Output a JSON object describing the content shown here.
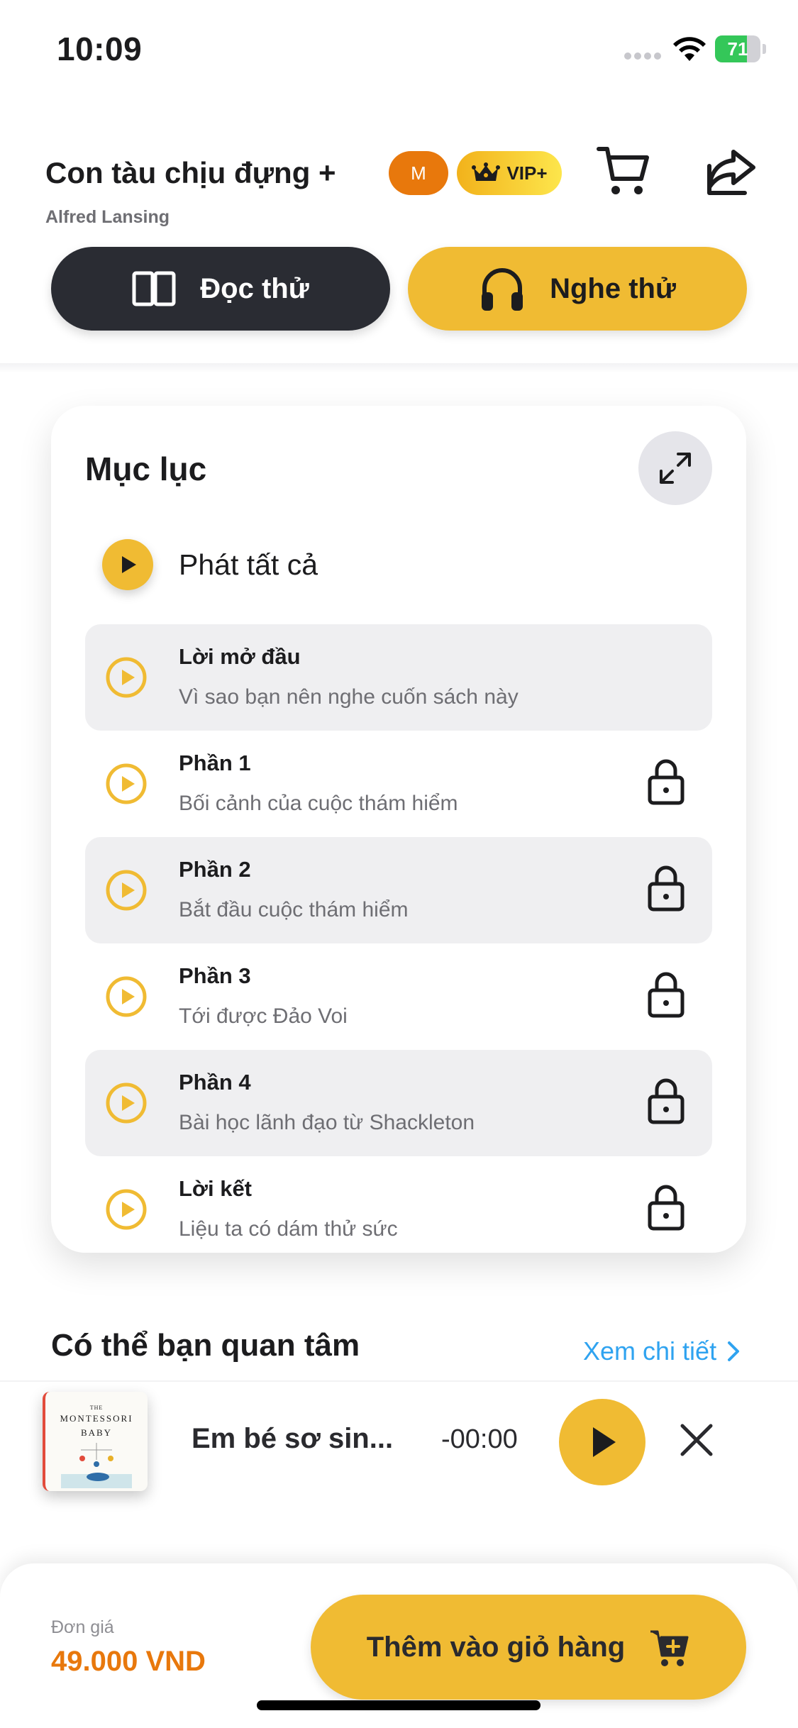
{
  "status_bar": {
    "time": "10:09",
    "battery": "71",
    "battery_level": 0.71
  },
  "header": {
    "title": "Con tàu chịu đựng +",
    "author": "Alfred Lansing",
    "badge_m": "M",
    "badge_vip": "VIP+",
    "icons": [
      "cart-icon",
      "share-icon"
    ]
  },
  "actions": {
    "read_label": "Đọc thử",
    "listen_label": "Nghe thử"
  },
  "toc": {
    "title": "Mục lục",
    "play_all": "Phát tất cả",
    "items": [
      {
        "name": "Lời mở đầu",
        "subtitle": "Vì sao bạn nên nghe cuốn sách này",
        "locked": false
      },
      {
        "name": "Phần 1",
        "subtitle": "Bối cảnh của cuộc thám hiểm",
        "locked": true
      },
      {
        "name": "Phần 2",
        "subtitle": "Bắt đầu cuộc thám hiểm",
        "locked": true
      },
      {
        "name": "Phần 3",
        "subtitle": "Tới được Đảo Voi",
        "locked": true
      },
      {
        "name": "Phần 4",
        "subtitle": "Bài học lãnh đạo từ Shackleton",
        "locked": true
      },
      {
        "name": "Lời kết",
        "subtitle": "Liệu ta có dám thử sức",
        "locked": true
      }
    ]
  },
  "recommend": {
    "title": "Có thể bạn quan tâm",
    "more": "Xem chi tiết"
  },
  "player": {
    "cover_line1": "THE",
    "cover_line2": "MONTESSORI",
    "cover_line3": "BABY",
    "title": "Em bé sơ sin...",
    "time": "-00:00"
  },
  "purchase": {
    "price_label": "Đơn giá",
    "price": "49.000 VND",
    "add_to_cart": "Thêm vào giỏ hàng"
  },
  "colors": {
    "accent": "#f0bb33",
    "dark": "#2a2c33",
    "price": "#e8780c",
    "link": "#2fa3f0"
  }
}
